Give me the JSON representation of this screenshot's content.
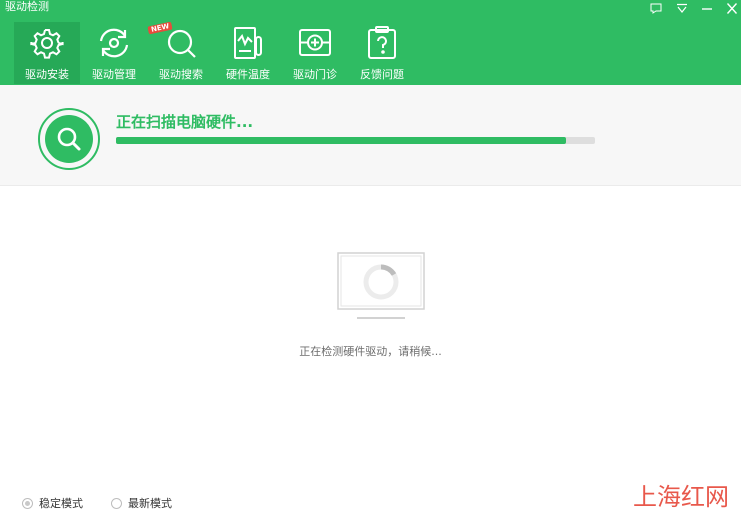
{
  "app": {
    "title": "驱动检测"
  },
  "window_controls": [
    {
      "name": "feedback-icon"
    },
    {
      "name": "menu-icon"
    },
    {
      "name": "minimize-icon"
    },
    {
      "name": "close-icon"
    }
  ],
  "tabs": [
    {
      "label": "驱动安装",
      "icon": "gear-icon",
      "active": true
    },
    {
      "label": "驱动管理",
      "icon": "refresh-icon",
      "active": false
    },
    {
      "label": "驱动搜索",
      "icon": "search-icon",
      "active": false,
      "badge": "NEW"
    },
    {
      "label": "硬件温度",
      "icon": "thermometer-icon",
      "active": false
    },
    {
      "label": "驱动门诊",
      "icon": "medical-kit-icon",
      "active": false
    },
    {
      "label": "反馈问题",
      "icon": "question-icon",
      "active": false
    }
  ],
  "scan": {
    "title": "正在扫描电脑硬件...",
    "progress": 0.94
  },
  "detect": {
    "text": "正在检测硬件驱动，请稍候..."
  },
  "modes": [
    {
      "label": "稳定模式",
      "checked": true
    },
    {
      "label": "最新模式",
      "checked": false
    }
  ],
  "watermark": "上海红网",
  "colors": {
    "accent": "#2fbc63",
    "active_tab": "#26a957",
    "watermark": "#e8584b"
  }
}
